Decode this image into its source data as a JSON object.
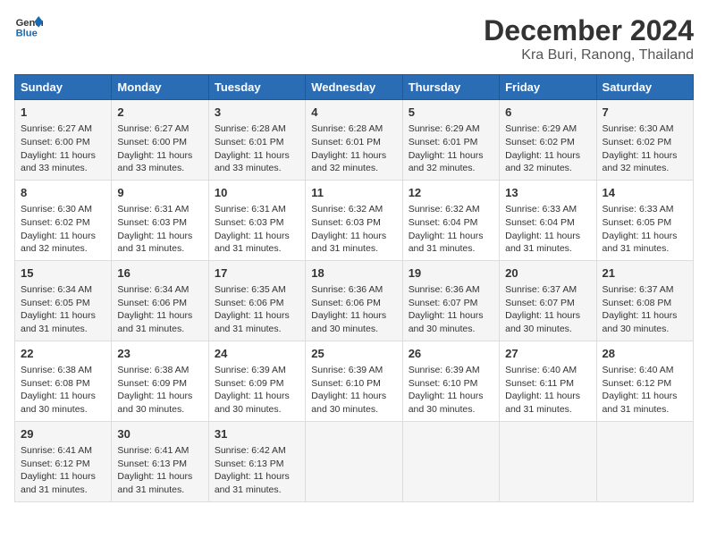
{
  "header": {
    "logo_line1": "General",
    "logo_line2": "Blue",
    "main_title": "December 2024",
    "sub_title": "Kra Buri, Ranong, Thailand"
  },
  "days_of_week": [
    "Sunday",
    "Monday",
    "Tuesday",
    "Wednesday",
    "Thursday",
    "Friday",
    "Saturday"
  ],
  "weeks": [
    [
      {
        "day": "1",
        "sunrise": "6:27 AM",
        "sunset": "6:00 PM",
        "daylight": "11 hours and 33 minutes."
      },
      {
        "day": "2",
        "sunrise": "6:27 AM",
        "sunset": "6:00 PM",
        "daylight": "11 hours and 33 minutes."
      },
      {
        "day": "3",
        "sunrise": "6:28 AM",
        "sunset": "6:01 PM",
        "daylight": "11 hours and 33 minutes."
      },
      {
        "day": "4",
        "sunrise": "6:28 AM",
        "sunset": "6:01 PM",
        "daylight": "11 hours and 32 minutes."
      },
      {
        "day": "5",
        "sunrise": "6:29 AM",
        "sunset": "6:01 PM",
        "daylight": "11 hours and 32 minutes."
      },
      {
        "day": "6",
        "sunrise": "6:29 AM",
        "sunset": "6:02 PM",
        "daylight": "11 hours and 32 minutes."
      },
      {
        "day": "7",
        "sunrise": "6:30 AM",
        "sunset": "6:02 PM",
        "daylight": "11 hours and 32 minutes."
      }
    ],
    [
      {
        "day": "8",
        "sunrise": "6:30 AM",
        "sunset": "6:02 PM",
        "daylight": "11 hours and 32 minutes."
      },
      {
        "day": "9",
        "sunrise": "6:31 AM",
        "sunset": "6:03 PM",
        "daylight": "11 hours and 31 minutes."
      },
      {
        "day": "10",
        "sunrise": "6:31 AM",
        "sunset": "6:03 PM",
        "daylight": "11 hours and 31 minutes."
      },
      {
        "day": "11",
        "sunrise": "6:32 AM",
        "sunset": "6:03 PM",
        "daylight": "11 hours and 31 minutes."
      },
      {
        "day": "12",
        "sunrise": "6:32 AM",
        "sunset": "6:04 PM",
        "daylight": "11 hours and 31 minutes."
      },
      {
        "day": "13",
        "sunrise": "6:33 AM",
        "sunset": "6:04 PM",
        "daylight": "11 hours and 31 minutes."
      },
      {
        "day": "14",
        "sunrise": "6:33 AM",
        "sunset": "6:05 PM",
        "daylight": "11 hours and 31 minutes."
      }
    ],
    [
      {
        "day": "15",
        "sunrise": "6:34 AM",
        "sunset": "6:05 PM",
        "daylight": "11 hours and 31 minutes."
      },
      {
        "day": "16",
        "sunrise": "6:34 AM",
        "sunset": "6:06 PM",
        "daylight": "11 hours and 31 minutes."
      },
      {
        "day": "17",
        "sunrise": "6:35 AM",
        "sunset": "6:06 PM",
        "daylight": "11 hours and 31 minutes."
      },
      {
        "day": "18",
        "sunrise": "6:36 AM",
        "sunset": "6:06 PM",
        "daylight": "11 hours and 30 minutes."
      },
      {
        "day": "19",
        "sunrise": "6:36 AM",
        "sunset": "6:07 PM",
        "daylight": "11 hours and 30 minutes."
      },
      {
        "day": "20",
        "sunrise": "6:37 AM",
        "sunset": "6:07 PM",
        "daylight": "11 hours and 30 minutes."
      },
      {
        "day": "21",
        "sunrise": "6:37 AM",
        "sunset": "6:08 PM",
        "daylight": "11 hours and 30 minutes."
      }
    ],
    [
      {
        "day": "22",
        "sunrise": "6:38 AM",
        "sunset": "6:08 PM",
        "daylight": "11 hours and 30 minutes."
      },
      {
        "day": "23",
        "sunrise": "6:38 AM",
        "sunset": "6:09 PM",
        "daylight": "11 hours and 30 minutes."
      },
      {
        "day": "24",
        "sunrise": "6:39 AM",
        "sunset": "6:09 PM",
        "daylight": "11 hours and 30 minutes."
      },
      {
        "day": "25",
        "sunrise": "6:39 AM",
        "sunset": "6:10 PM",
        "daylight": "11 hours and 30 minutes."
      },
      {
        "day": "26",
        "sunrise": "6:39 AM",
        "sunset": "6:10 PM",
        "daylight": "11 hours and 30 minutes."
      },
      {
        "day": "27",
        "sunrise": "6:40 AM",
        "sunset": "6:11 PM",
        "daylight": "11 hours and 31 minutes."
      },
      {
        "day": "28",
        "sunrise": "6:40 AM",
        "sunset": "6:12 PM",
        "daylight": "11 hours and 31 minutes."
      }
    ],
    [
      {
        "day": "29",
        "sunrise": "6:41 AM",
        "sunset": "6:12 PM",
        "daylight": "11 hours and 31 minutes."
      },
      {
        "day": "30",
        "sunrise": "6:41 AM",
        "sunset": "6:13 PM",
        "daylight": "11 hours and 31 minutes."
      },
      {
        "day": "31",
        "sunrise": "6:42 AM",
        "sunset": "6:13 PM",
        "daylight": "11 hours and 31 minutes."
      },
      null,
      null,
      null,
      null
    ]
  ],
  "labels": {
    "sunrise": "Sunrise: ",
    "sunset": "Sunset: ",
    "daylight": "Daylight: "
  }
}
